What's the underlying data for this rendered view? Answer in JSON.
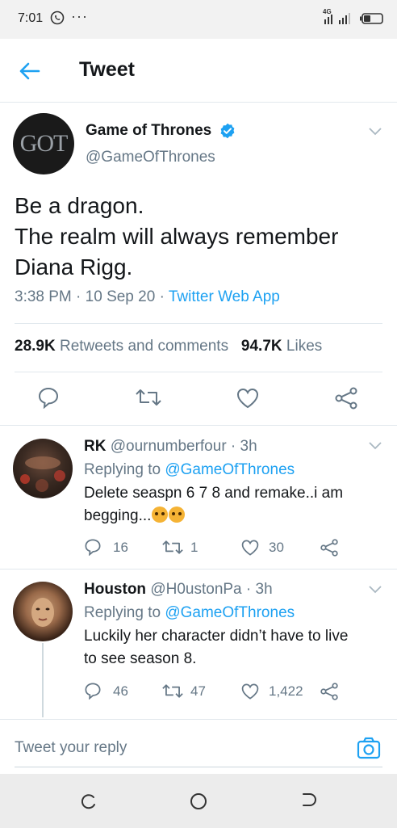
{
  "status_bar": {
    "time": "7:01",
    "more": "···",
    "network": "4G"
  },
  "header": {
    "title": "Tweet"
  },
  "tweet": {
    "author_name": "Game of Thrones",
    "author_handle": "@GameOfThrones",
    "avatar_text": "GOT",
    "text_lines": [
      "Be a dragon.",
      "The realm will always remember",
      "Diana Rigg."
    ],
    "time": "3:38 PM",
    "date": "10 Sep 20",
    "source": "Twitter Web App",
    "retweets_count": "28.9K",
    "retweets_label": "Retweets and comments",
    "likes_count": "94.7K",
    "likes_label": "Likes"
  },
  "replies": [
    {
      "name": "RK",
      "handle": "@ournumberfour",
      "age": "3h",
      "replying_label": "Replying to",
      "replying_to": "@GameOfThrones",
      "text_line1": "Delete seaspn 6 7 8 and remake..i am",
      "text_line2": "begging...",
      "reply_count": "16",
      "retweet_count": "1",
      "like_count": "30"
    },
    {
      "name": "Houston",
      "handle": "@H0ustonPa",
      "age": "3h",
      "replying_label": "Replying to",
      "replying_to": "@GameOfThrones",
      "text_line1": "Luckily her character didn’t have to live",
      "text_line2": "to see season 8.",
      "reply_count": "46",
      "retweet_count": "47",
      "like_count": "1,422"
    }
  ],
  "reply_bar": {
    "placeholder": "Tweet your reply"
  },
  "colors": {
    "accent": "#1da1f2",
    "muted": "#657786",
    "text": "#14171a",
    "divider": "#e1e8ed"
  }
}
